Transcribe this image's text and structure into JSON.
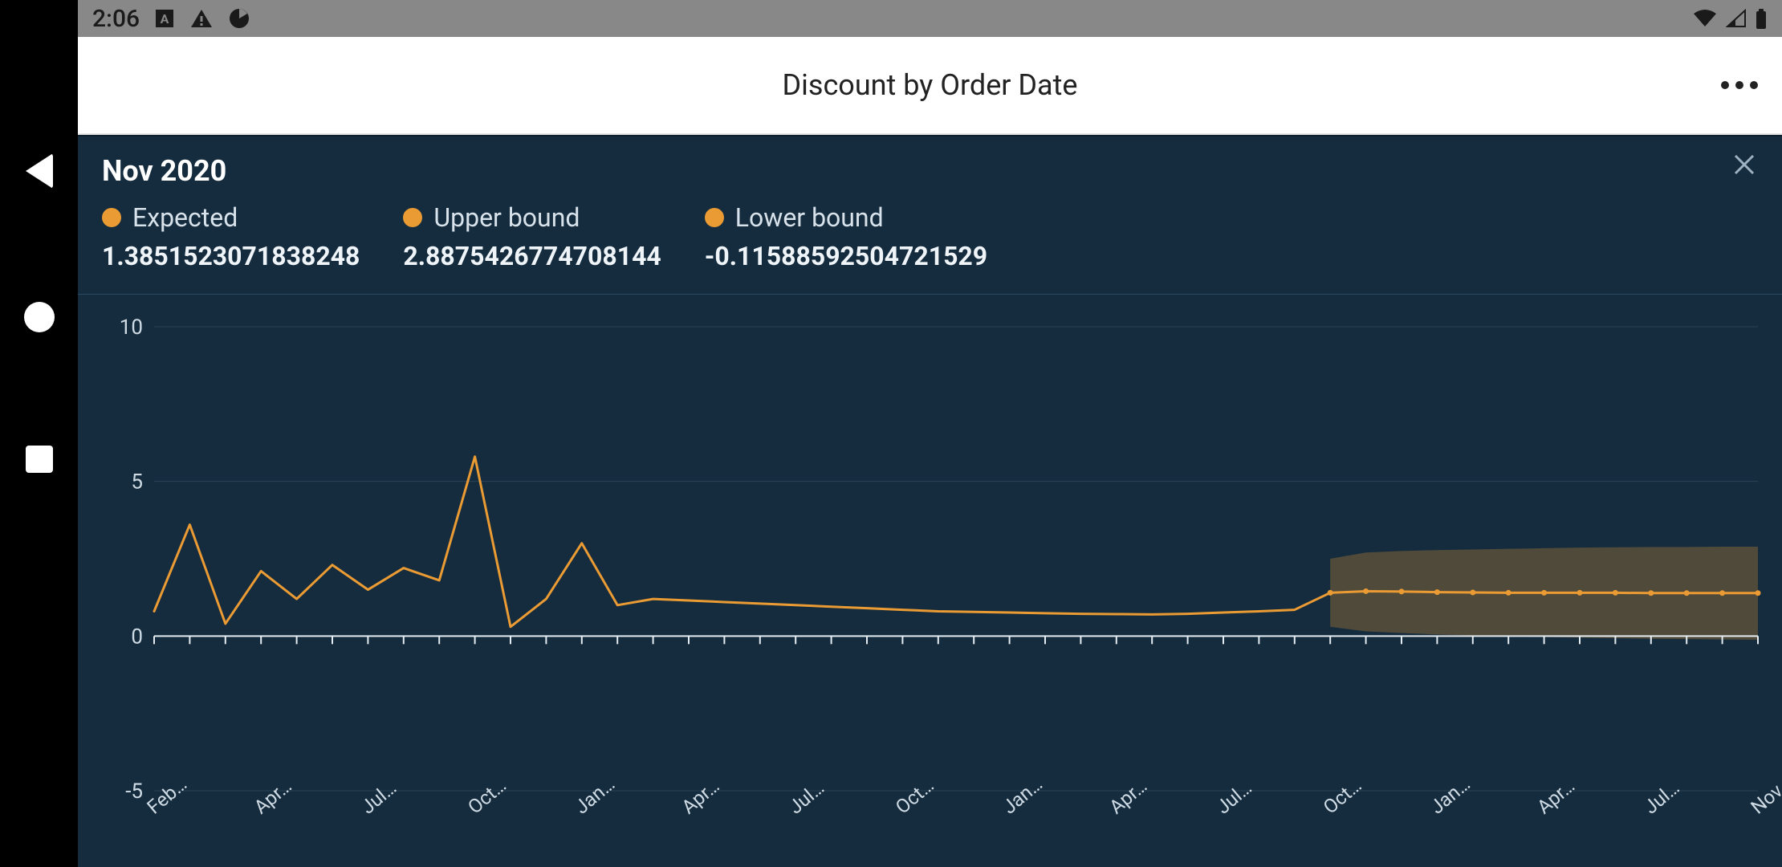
{
  "status_bar": {
    "time": "2:06"
  },
  "titlebar": {
    "title": "Discount by Order Date"
  },
  "panel": {
    "selected_date": "Nov 2020",
    "metrics": [
      {
        "key": "expected",
        "label": "Expected",
        "value": "1.3851523071838248",
        "color": "#eb9b33"
      },
      {
        "key": "upper",
        "label": "Upper bound",
        "value": "2.8875426774708144",
        "color": "#eb9b33"
      },
      {
        "key": "lower",
        "label": "Lower bound",
        "value": "-0.11588592504721529",
        "color": "#eb9b33"
      }
    ]
  },
  "chart_data": {
    "type": "line",
    "title": "Discount by Order Date",
    "xlabel": "",
    "ylabel": "",
    "ylim": [
      -5,
      10
    ],
    "y_ticks": [
      -5,
      0,
      5,
      10
    ],
    "x_tick_labels": [
      "Feb…",
      "Apr…",
      "Jul…",
      "Oct…",
      "Jan…",
      "Apr…",
      "Jul…",
      "Oct…",
      "Jan…",
      "Apr…",
      "Jul…",
      "Oct…",
      "Jan…",
      "Apr…",
      "Jul…",
      "Nov…"
    ],
    "series": [
      {
        "name": "Discount",
        "color": "#eb9b33",
        "x_index": [
          0,
          1,
          2,
          3,
          4,
          5,
          6,
          7,
          8,
          9,
          10,
          11,
          12,
          13,
          14,
          15,
          16,
          17,
          18,
          19,
          20,
          21,
          22,
          23,
          24,
          25,
          26,
          27,
          28,
          29,
          30,
          31,
          32,
          33,
          34,
          35,
          36,
          37,
          38,
          39,
          40,
          41,
          42,
          43,
          44,
          45
        ],
        "values": [
          0.8,
          3.6,
          0.4,
          2.1,
          1.2,
          2.3,
          1.5,
          2.2,
          1.8,
          5.8,
          0.3,
          1.2,
          3.0,
          1.0,
          1.2,
          1.15,
          1.1,
          1.05,
          1.0,
          0.95,
          0.9,
          0.85,
          0.8,
          0.78,
          0.76,
          0.74,
          0.72,
          0.71,
          0.7,
          0.72,
          0.76,
          0.8,
          0.85,
          1.4,
          1.45,
          1.44,
          1.42,
          1.41,
          1.4,
          1.4,
          1.4,
          1.4,
          1.39,
          1.39,
          1.39,
          1.39
        ]
      }
    ],
    "forecast": {
      "start_index": 33,
      "end_index": 45,
      "expected": [
        1.4,
        1.45,
        1.44,
        1.42,
        1.41,
        1.4,
        1.4,
        1.4,
        1.4,
        1.39,
        1.39,
        1.39,
        1.39
      ],
      "upper": [
        2.5,
        2.7,
        2.75,
        2.78,
        2.8,
        2.82,
        2.84,
        2.86,
        2.87,
        2.88,
        2.88,
        2.89,
        2.89
      ],
      "lower": [
        0.3,
        0.15,
        0.1,
        0.05,
        0.02,
        0.0,
        -0.03,
        -0.05,
        -0.07,
        -0.09,
        -0.1,
        -0.11,
        -0.12
      ]
    }
  }
}
